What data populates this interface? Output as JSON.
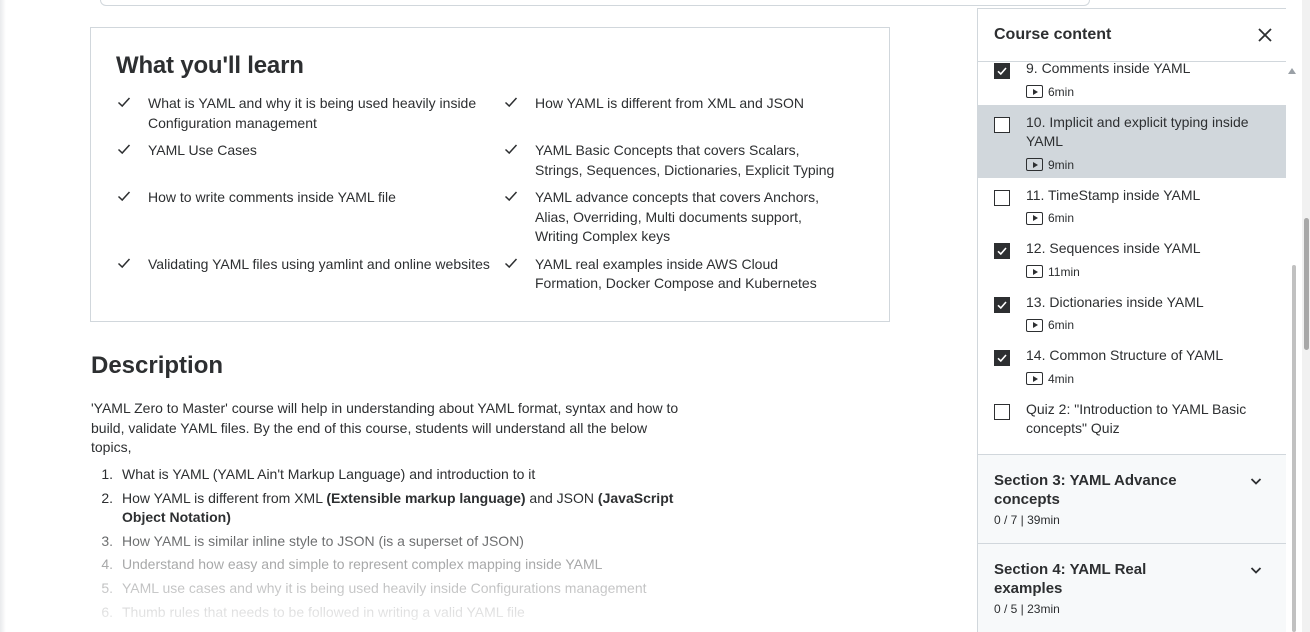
{
  "learn": {
    "title": "What you'll learn",
    "items": [
      "What is YAML and why it is being used heavily inside Configuration management",
      "How YAML is different from XML and JSON",
      "YAML Use Cases",
      "YAML Basic Concepts that covers Scalars, Strings, Sequences, Dictionaries, Explicit Typing",
      "How to write comments inside YAML file",
      "YAML advance concepts that covers Anchors, Alias, Overriding, Multi documents support, Writing Complex keys",
      "Validating YAML files using yamlint and online websites",
      "YAML real examples inside AWS Cloud Formation, Docker Compose and Kubernetes"
    ]
  },
  "description": {
    "title": "Description",
    "paragraph": "'YAML Zero to Master' course will help in understanding about YAML format, syntax and how to build, validate YAML files. By the end of this course, students will understand all the below topics,",
    "list": [
      {
        "num": "1.",
        "parts": [
          {
            "t": "What is YAML (YAML Ain't Markup Language) and introduction to it",
            "b": false
          }
        ]
      },
      {
        "num": "2.",
        "parts": [
          {
            "t": "How YAML is different from XML ",
            "b": false
          },
          {
            "t": "(Extensible markup language)",
            "b": true
          },
          {
            "t": " and JSON ",
            "b": false
          },
          {
            "t": "(JavaScript Object Notation)",
            "b": true
          }
        ]
      },
      {
        "num": "3.",
        "parts": [
          {
            "t": "How YAML is similar inline style to JSON (is a superset of JSON)",
            "b": false
          }
        ]
      },
      {
        "num": "4.",
        "parts": [
          {
            "t": "Understand how easy and simple to represent complex mapping inside YAML",
            "b": false
          }
        ]
      },
      {
        "num": "5.",
        "parts": [
          {
            "t": "YAML use cases and why it is being used heavily inside Configurations management",
            "b": false
          }
        ]
      },
      {
        "num": "6.",
        "parts": [
          {
            "t": "Thumb rules that needs to be followed in writing a valid YAML file",
            "b": false
          }
        ]
      }
    ]
  },
  "sidebar": {
    "title": "Course content",
    "lectures": [
      {
        "title": "9. Comments inside YAML",
        "duration": "6min",
        "checked": true,
        "active": false,
        "type": "video"
      },
      {
        "title": "10. Implicit and explicit typing inside YAML",
        "duration": "9min",
        "checked": false,
        "active": true,
        "type": "video"
      },
      {
        "title": "11. TimeStamp inside YAML",
        "duration": "6min",
        "checked": false,
        "active": false,
        "type": "video"
      },
      {
        "title": "12. Sequences inside YAML",
        "duration": "11min",
        "checked": true,
        "active": false,
        "type": "video"
      },
      {
        "title": "13. Dictionaries inside YAML",
        "duration": "6min",
        "checked": true,
        "active": false,
        "type": "video"
      },
      {
        "title": "14. Common Structure of YAML",
        "duration": "4min",
        "checked": true,
        "active": false,
        "type": "video"
      },
      {
        "title": "Quiz 2: \"Introduction to YAML Basic concepts\" Quiz",
        "duration": "",
        "checked": false,
        "active": false,
        "type": "quiz"
      }
    ],
    "sections": [
      {
        "title": "Section 3: YAML Advance concepts",
        "meta": "0 / 7 | 39min"
      },
      {
        "title": "Section 4: YAML Real examples",
        "meta": "0 / 5 | 23min"
      }
    ]
  }
}
